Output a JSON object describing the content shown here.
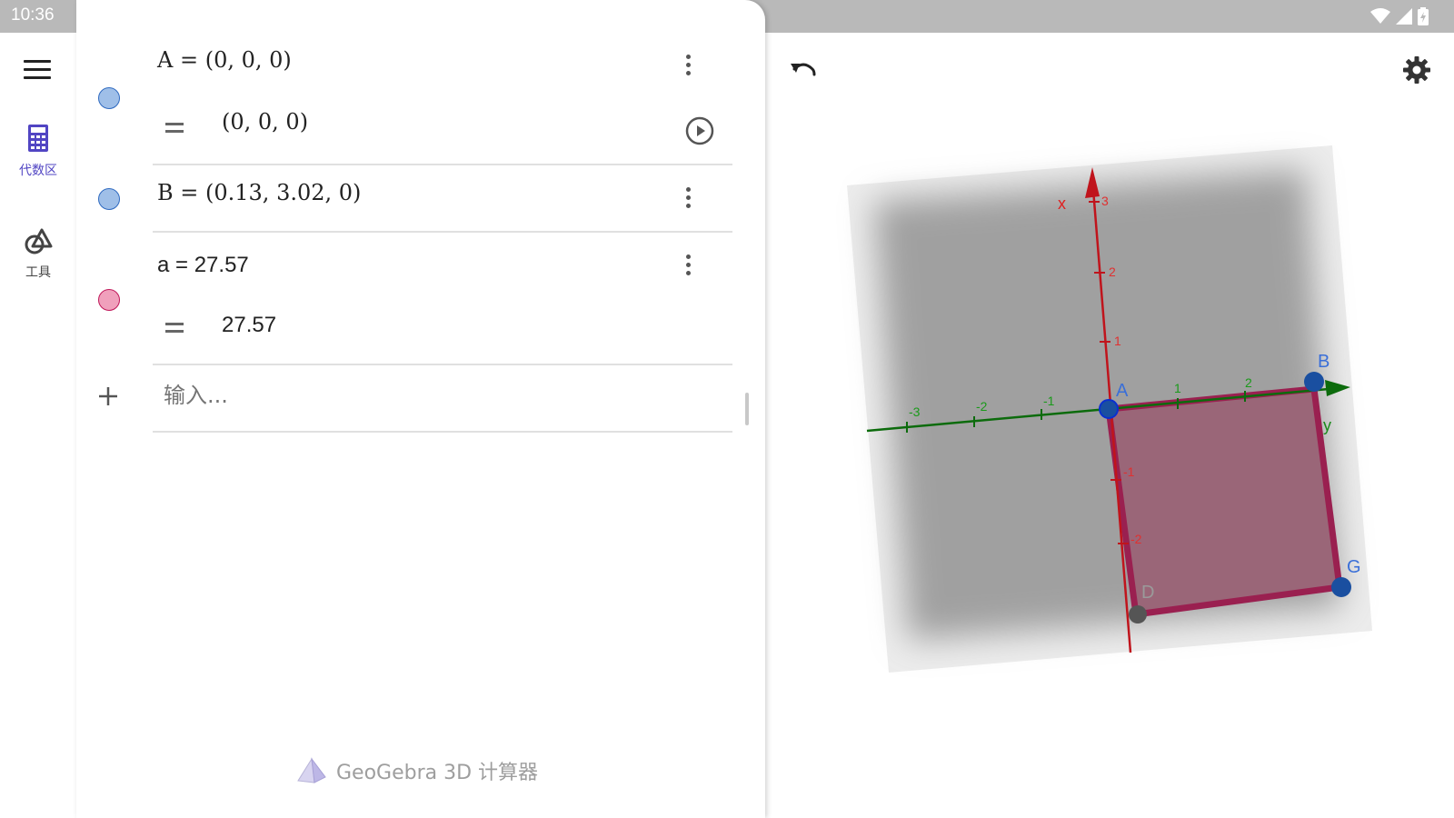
{
  "status": {
    "time": "10:36"
  },
  "rail": {
    "algebra_label": "代数区",
    "tools_label": "工具"
  },
  "algebra": {
    "items": [
      {
        "definition": "A = (0, 0, 0)",
        "value": "(0, 0, 0)",
        "color": "#9fbfe8"
      },
      {
        "definition": "B = (0.13, 3.02, 0)",
        "color": "#9fbfe8"
      },
      {
        "definition": "a = 27.57",
        "value": "27.57",
        "color": "#f0a0bc"
      }
    ],
    "input_placeholder": "输入..."
  },
  "footer": {
    "app_name": "GeoGebra 3D 计算器"
  },
  "graphics": {
    "x_axis_label": "x",
    "y_axis_label": "y",
    "x_ticks": [
      "3",
      "2",
      "1",
      "-1",
      "-2"
    ],
    "y_ticks": [
      "-3",
      "-2",
      "-1",
      "1",
      "2"
    ],
    "points": [
      "A",
      "B",
      "G",
      "D"
    ],
    "axis_colors": {
      "x": "#c0141c",
      "y": "#0c6b0c"
    },
    "polygon_color": "#9a2050",
    "point_color": "#1a4fa0"
  }
}
